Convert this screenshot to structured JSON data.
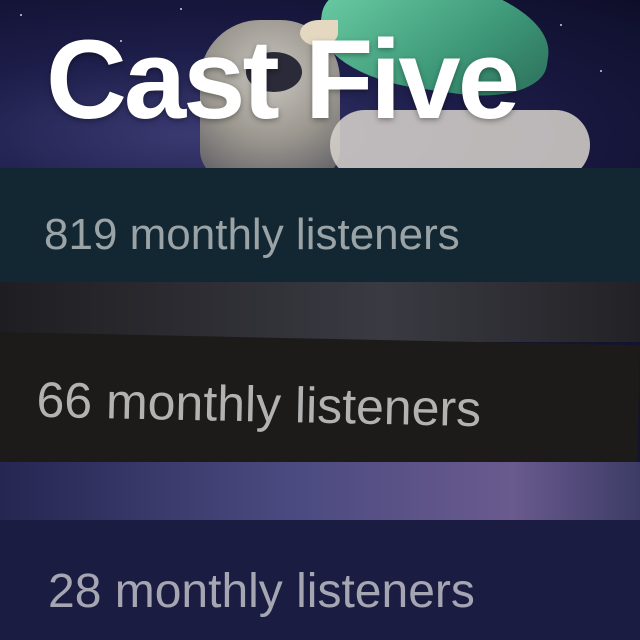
{
  "hero": {
    "artist_name": "Cast Five"
  },
  "rows": [
    {
      "listeners": "819 monthly listeners"
    },
    {
      "listeners": "66 monthly listeners"
    },
    {
      "listeners": "28 monthly listeners"
    }
  ],
  "colors": {
    "row1_bg": "#132733",
    "row2_bg": "#1d1b1a",
    "row3_bg": "#1a1c42",
    "listener_text": "#a9a9a9"
  }
}
